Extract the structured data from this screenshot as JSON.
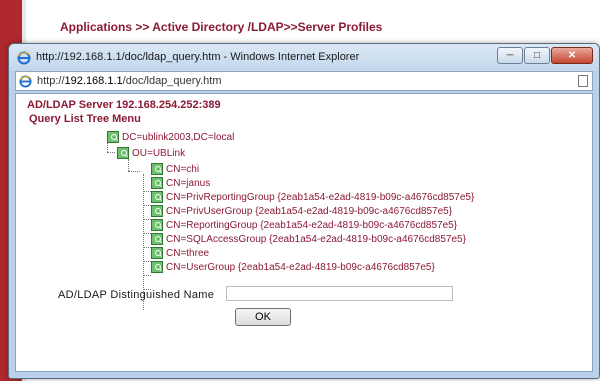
{
  "background": {
    "breadcrumb": "Applications >> Active Directory /LDAP>>Server Profiles"
  },
  "window": {
    "title": "http://192.168.1.1/doc/ldap_query.htm - Windows Internet Explorer",
    "address": "http://192.168.1.1/doc/ldap_query.htm",
    "address_host": "192.168.1.1",
    "address_prefix": "http://",
    "address_path": "/doc/ldap_query.htm",
    "buttons": {
      "minimize": "─",
      "maximize": "□",
      "close": "✕"
    }
  },
  "content": {
    "server_title": "AD/LDAP Server 192.168.254.252:389",
    "tree_menu_title": "Query List Tree Menu",
    "tree": {
      "root": "DC=ublink2003,DC=local",
      "ou": "OU=UBLink",
      "children": [
        "CN=chi",
        "CN=janus",
        "CN=PrivReportingGroup {2eab1a54-e2ad-4819-b09c-a4676cd857e5}",
        "CN=PrivUserGroup {2eab1a54-e2ad-4819-b09c-a4676cd857e5}",
        "CN=ReportingGroup {2eab1a54-e2ad-4819-b09c-a4676cd857e5}",
        "CN=SQLAccessGroup {2eab1a54-e2ad-4819-b09c-a4676cd857e5}",
        "CN=three",
        "CN=UserGroup {2eab1a54-e2ad-4819-b09c-a4676cd857e5}"
      ]
    },
    "dn_label": "AD/LDAP Distinguished Name",
    "dn_value": "",
    "ok_label": "OK"
  },
  "colors": {
    "accent": "#8b1a35",
    "tree_icon": "#6fc06f"
  }
}
